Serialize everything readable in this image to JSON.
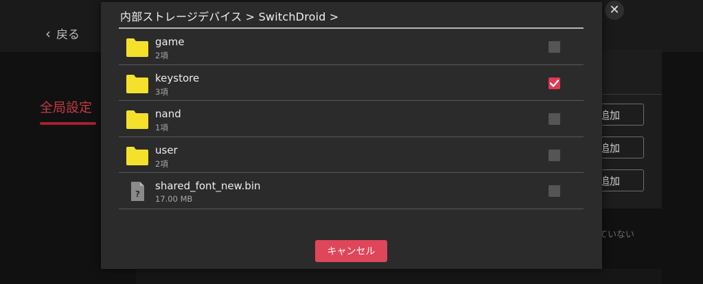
{
  "background": {
    "back_label": "戻る",
    "sidebar_item": "全局設定",
    "add_buttons": [
      "追加",
      "追加",
      "追加"
    ],
    "note_fragment": "ていない",
    "close_icon": "close-icon"
  },
  "dialog": {
    "path": "内部ストレージデバイス > SwitchDroid >",
    "items": [
      {
        "name": "game",
        "meta": "2項",
        "type": "folder",
        "checked": false
      },
      {
        "name": "keystore",
        "meta": "3項",
        "type": "folder",
        "checked": true
      },
      {
        "name": "nand",
        "meta": "1項",
        "type": "folder",
        "checked": false
      },
      {
        "name": "user",
        "meta": "2項",
        "type": "folder",
        "checked": false
      },
      {
        "name": "shared_font_new.bin",
        "meta": "17.00 MB",
        "type": "file",
        "checked": false
      }
    ],
    "cancel_label": "キャンセル"
  },
  "colors": {
    "accent": "#e0465a",
    "folder": "#f5e12c",
    "check_on": "#e13a52",
    "check_off": "#555555"
  }
}
